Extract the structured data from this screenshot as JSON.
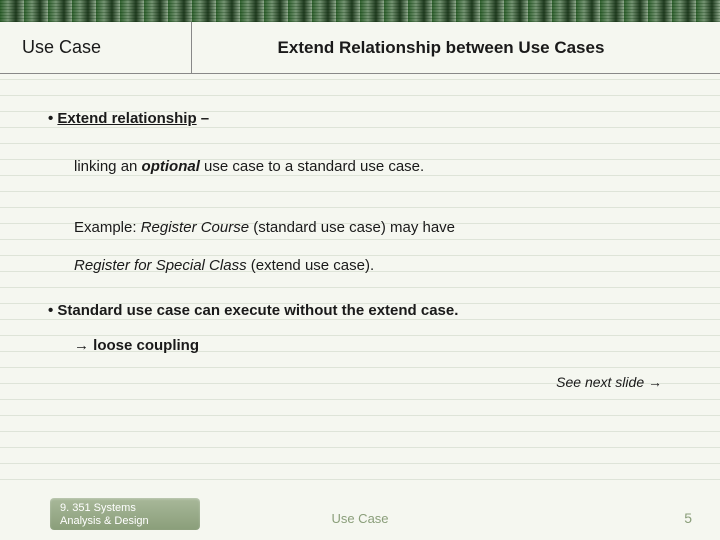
{
  "header": {
    "left": "Use Case",
    "right": "Extend Relationship between Use Cases"
  },
  "content": {
    "bullet1_prefix": "• ",
    "bullet1_underlined": "Extend relationship",
    "bullet1_suffix": " –",
    "line_linking_pre": "linking an ",
    "line_linking_optional": "optional",
    "line_linking_post": " use case to a standard use case.",
    "example_pre": "Example: ",
    "example_rc": "Register Course",
    "example_mid": " (standard use case) may have ",
    "example_rsc": "Register for Special Class",
    "example_post": " (extend use case).",
    "bullet2": "• Standard use case can execute without the extend case.",
    "arrow": "→",
    "loose": " loose coupling",
    "see_next_pre": "See next slide ",
    "see_next_arrow": "→"
  },
  "footer": {
    "course_line1": "9. 351    Systems",
    "course_line2": "Analysis & Design",
    "center": "Use Case",
    "page": "5"
  }
}
